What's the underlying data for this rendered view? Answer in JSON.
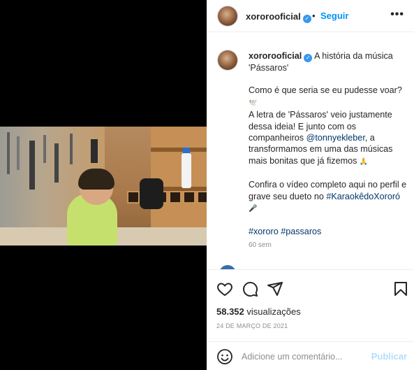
{
  "post": {
    "username": "xororooficial",
    "follow_label": "Seguir",
    "more_label": "•••",
    "separator": "•"
  },
  "caption": {
    "username": "xororooficial",
    "title_text": "A história da música 'Pássaros'",
    "line1": "Como é que seria se eu pudesse voar?",
    "line1_emoji": "🕊️",
    "line2a": "A letra de 'Pássaros' veio justamente dessa ideia! E junto com os companheiros ",
    "mention": "@tonnyekleber",
    "line2b": ", a transformamos em uma das músicas mais bonitas que já fizemos",
    "line2_emoji": "🙏",
    "line3a": "Confira o vídeo completo aqui no perfil e grave seu dueto no ",
    "hashtag1": "#KaraokêdoXororó",
    "line3_emoji": "🎤",
    "hashtag2": "#xororo",
    "hashtag3": "#passaros",
    "time_ago": "60 sem"
  },
  "stats": {
    "views_count": "58.352",
    "views_label": "visualizações",
    "date": "24 DE MARÇO DE 2021"
  },
  "comment_box": {
    "placeholder": "Adicione um comentário...",
    "publish_label": "Publicar"
  },
  "icons": [
    "heart-icon",
    "comment-icon",
    "share-icon",
    "bookmark-icon",
    "smile-icon",
    "verified-icon",
    "more-options-icon"
  ],
  "colors": {
    "link": "#0095f6",
    "mention": "#00376b",
    "verified": "#3897f0",
    "publish_disabled": "#b2dffc"
  }
}
